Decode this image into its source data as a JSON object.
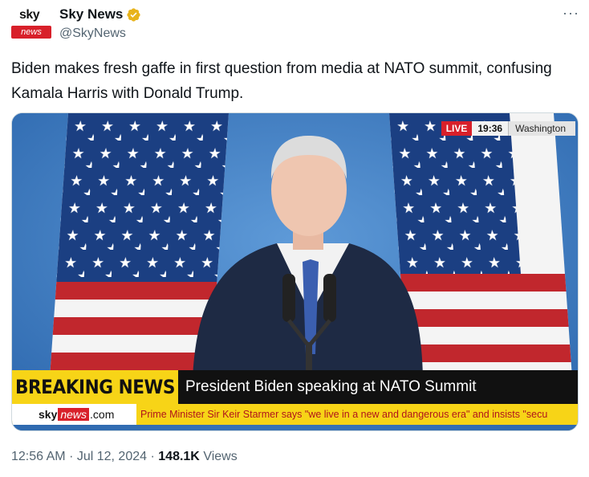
{
  "author": {
    "display_name": "Sky News",
    "handle": "@SkyNews",
    "avatar_top": "sky",
    "avatar_bottom": "news"
  },
  "more_menu": "···",
  "tweet_text": "Biden makes fresh gaffe in first question from media at NATO summit, confusing Kamala Harris with Donald Trump.",
  "video": {
    "live_label": "LIVE",
    "time": "19:36",
    "location": "Washington",
    "breaking_label": "BREAKING NEWS",
    "headline": "President Biden speaking at NATO Summit",
    "logo_sky": "sky",
    "logo_news": "news",
    "logo_com": ".com",
    "ticker": "Prime Minister Sir Keir Starmer says \"we live in a new and dangerous era\" and insists \"secu"
  },
  "footer": {
    "time": "12:56 AM",
    "sep1": "·",
    "date": "Jul 12, 2024",
    "sep2": "·",
    "views_count": "148.1K",
    "views_label": "Views"
  },
  "colors": {
    "brand_red": "#d8202a",
    "breaking_yellow": "#f7d417",
    "verified_gold": "#e8b31b"
  }
}
